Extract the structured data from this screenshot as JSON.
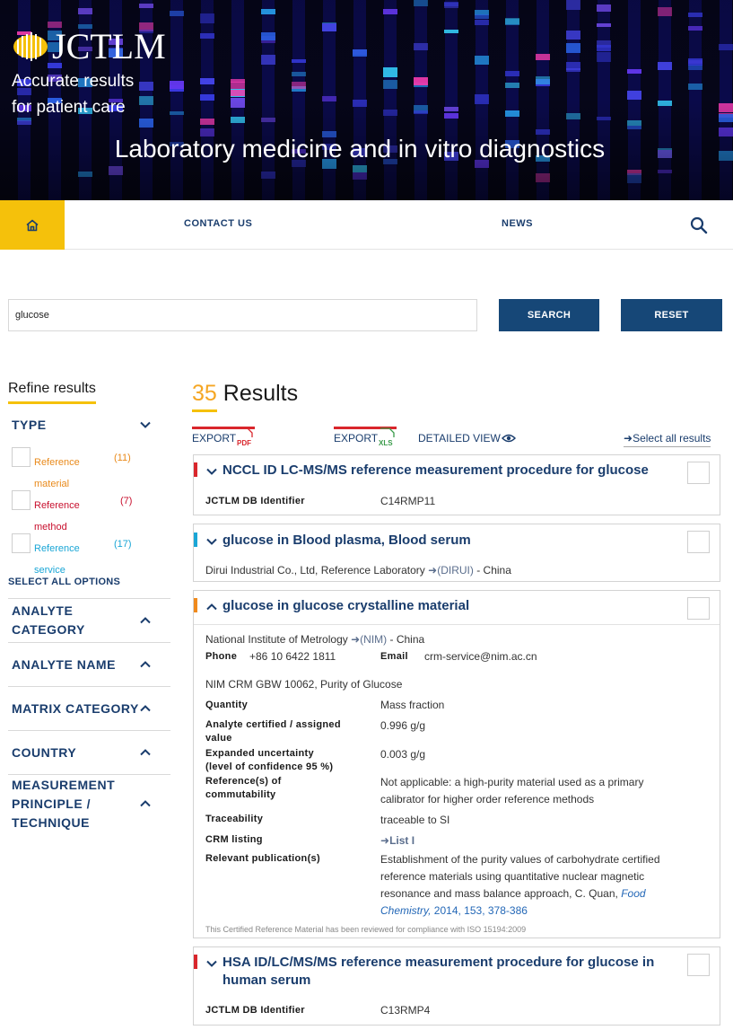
{
  "brand": {
    "logo_text": "JCTLM",
    "tagline_line1": "Accurate results",
    "tagline_line2": "for patient care",
    "hero_title": "Laboratory medicine and in vitro diagnostics"
  },
  "nav": {
    "home_icon": "home-icon",
    "contact": "CONTACT US",
    "news": "NEWS",
    "search_icon": "search-icon"
  },
  "search": {
    "value": "glucose",
    "search_label": "SEARCH",
    "reset_label": "RESET"
  },
  "sidebar": {
    "title": "Refine results",
    "type": {
      "label": "TYPE",
      "items": [
        {
          "label": "Reference material",
          "count": "(11)",
          "color": "#e98a1b"
        },
        {
          "label": "Reference method",
          "count": "(7)",
          "color": "#c8102e"
        },
        {
          "label": "Reference service",
          "count": "(17)",
          "color": "#1aa6d6"
        }
      ],
      "select_all": "SELECT ALL OPTIONS"
    },
    "facets": {
      "analyte_category": "ANALYTE CATEGORY",
      "analyte_name": "ANALYTE NAME",
      "matrix_category": "MATRIX CATEGORY",
      "country": "COUNTRY",
      "measurement": "MEASUREMENT PRINCIPLE / TECHNIQUE"
    }
  },
  "results": {
    "count": "35",
    "label": "Results",
    "export_pdf": "EXPORT",
    "export_xls": "EXPORT",
    "pdf_badge": "PDF",
    "xls_badge": "XLS",
    "detailed_view": "DETAILED VIEW",
    "select_all": "Select all results",
    "items": [
      {
        "title": "NCCL ID LC-MS/MS reference measurement procedure for glucose",
        "type_color": "#d9262c",
        "id_label": "JCTLM DB Identifier",
        "id_value": "C14RMP11"
      },
      {
        "title": "glucose in Blood plasma, Blood serum",
        "type_color": "#1aa6d6",
        "lab": "Dirui Industrial Co., Ltd, Reference Laboratory",
        "lab_code": "(DIRUI)",
        "lab_country": "- China"
      },
      {
        "title": "glucose in glucose crystalline material",
        "type_color": "#f08a1c",
        "institute": "National Institute of Metrology",
        "institute_code": "(NIM)",
        "institute_country": "- China",
        "phone_label": "Phone",
        "phone": "+86 10 6422 1811",
        "email_label": "Email",
        "email": "crm-service@nim.ac.cn",
        "material": "NIM CRM GBW 10062, Purity of Glucose",
        "quantity_label": "Quantity",
        "quantity": "Mass fraction",
        "assigned_label_1": "Analyte certified / assigned",
        "assigned_label_2": "value",
        "assigned": "0.996 g/g",
        "uncertainty_label_1": "Expanded uncertainty",
        "uncertainty_label_2": "(level of confidence 95 %)",
        "uncertainty": "0.003 g/g",
        "commut_label_1": "Reference(s) of",
        "commut_label_2": "commutability",
        "commut_1": "Not applicable: a high-purity material used as a primary",
        "commut_2": "calibrator for higher order reference methods",
        "traceability_label": "Traceability",
        "traceability": "traceable to SI",
        "crm_label": "CRM listing",
        "crm_link": "List I",
        "pub_label": "Relevant publication(s)",
        "pub_1": "Establishment of the purity values of carbohydrate certified",
        "pub_2": "reference materials using quantitative nuclear magnetic",
        "pub_3": "resonance and mass balance approach, C. Quan,",
        "pub_journal_a": "Food",
        "pub_journal_b": "Chemistry,",
        "pub_year": "2014,",
        "pub_vol": "153,",
        "pub_pages": "378-386",
        "note": "This Certified Reference Material has been reviewed for compliance with ISO 15194:2009"
      },
      {
        "title_1": "HSA ID/LC/MS/MS reference measurement procedure for glucose in",
        "title_2": "human serum",
        "type_color": "#d9262c",
        "id_label": "JCTLM DB Identifier",
        "id_value": "C13RMP4"
      }
    ]
  },
  "colors": {
    "navy": "#164777",
    "accent": "#f5c10b",
    "link": "#1a3d6d"
  }
}
